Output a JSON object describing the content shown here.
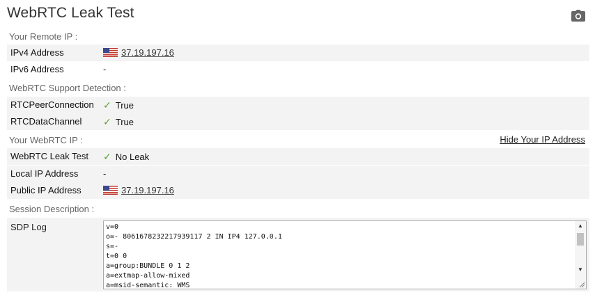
{
  "page": {
    "title": "WebRTC Leak Test",
    "camera_icon": "camera-icon"
  },
  "remote_ip": {
    "heading": "Your Remote IP :",
    "ipv4_label": "IPv4 Address",
    "ipv4_value": "37.19.197.16",
    "ipv4_flag": "us-flag-icon",
    "ipv6_label": "IPv6 Address",
    "ipv6_value": "-"
  },
  "support": {
    "heading": "WebRTC Support Detection :",
    "peer_label": "RTCPeerConnection",
    "peer_value": "True",
    "data_label": "RTCDataChannel",
    "data_value": "True",
    "check_color": "#5aa02c"
  },
  "webrtc_ip": {
    "heading": "Your WebRTC IP :",
    "hide_link": "Hide Your IP Address",
    "leak_label": "WebRTC Leak Test",
    "leak_value": "No Leak",
    "local_label": "Local IP Address",
    "local_value": "-",
    "public_label": "Public IP Address",
    "public_value": "37.19.197.16"
  },
  "session": {
    "heading": "Session Description :",
    "sdp_label": "SDP Log",
    "sdp_text": "v=0\no=- 8061678232217939117 2 IN IP4 127.0.0.1\ns=-\nt=0 0\na=group:BUNDLE 0 1 2\na=extmap-allow-mixed\na=msid-semantic: WMS"
  }
}
